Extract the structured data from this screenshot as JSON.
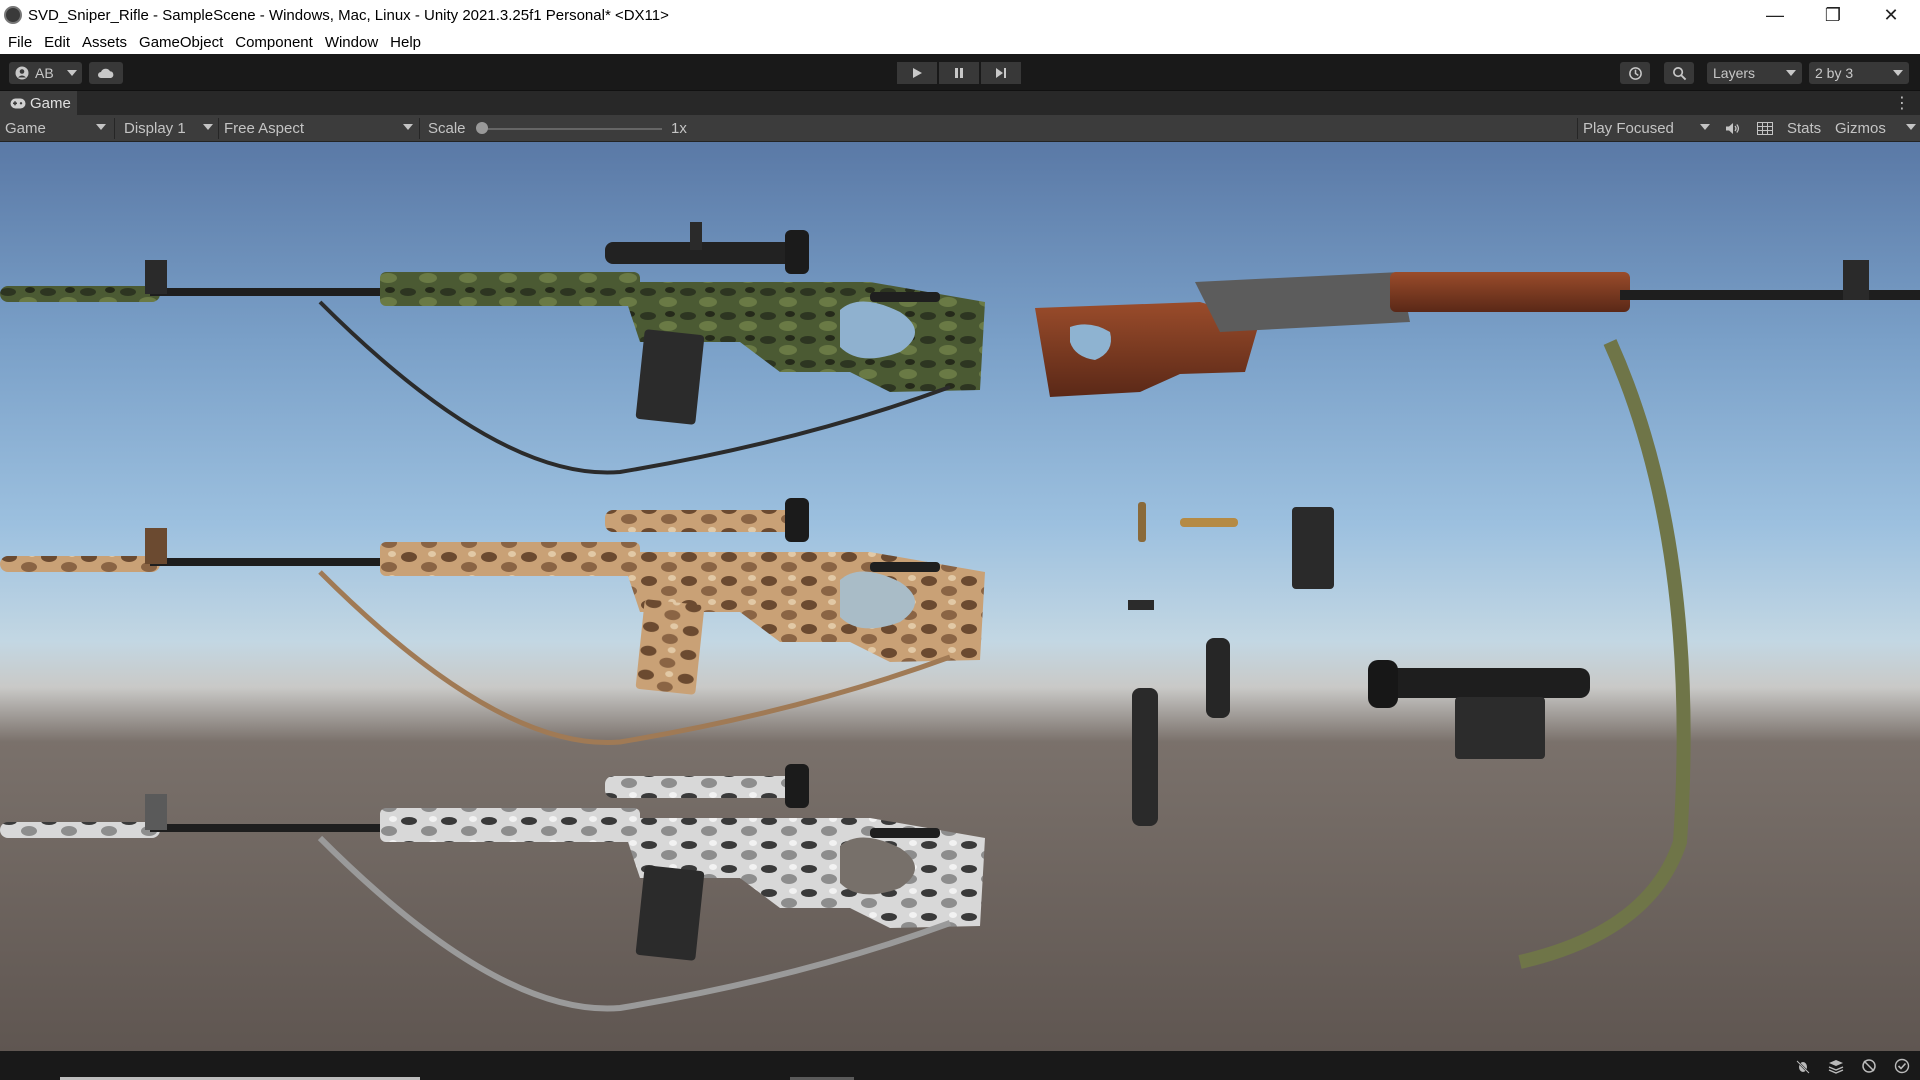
{
  "window": {
    "title": "SVD_Sniper_Rifle - SampleScene - Windows, Mac, Linux - Unity 2021.3.25f1 Personal* <DX11>",
    "controls": {
      "minimize": "—",
      "restore": "❐",
      "close": "✕"
    }
  },
  "menu": [
    "File",
    "Edit",
    "Assets",
    "GameObject",
    "Component",
    "Window",
    "Help"
  ],
  "toolbar": {
    "account_label": "AB",
    "layers_label": "Layers",
    "layout_label": "2 by 3",
    "icons": [
      "account-icon",
      "cloud-icon",
      "play-icon",
      "pause-icon",
      "step-icon",
      "history-icon",
      "search-icon"
    ]
  },
  "tab": {
    "label": "Game",
    "icon": "gamepad-icon"
  },
  "game_toolbar": {
    "view_mode": "Game",
    "display": "Display 1",
    "aspect": "Free Aspect",
    "scale_label": "Scale",
    "scale_value": "1x",
    "scale_level": 0,
    "play_mode": "Play Focused",
    "stats_label": "Stats",
    "gizmos_label": "Gizmos"
  },
  "status_icons": [
    "bug-icon",
    "layers-icon",
    "no-network-icon",
    "check-icon"
  ],
  "colors": {
    "camo_green": "#3f4a2c",
    "camo_desert": "#b28b62",
    "camo_winter": "#c8c8c8",
    "wood": "#7a3a22",
    "metal": "#222222",
    "sling_green": "#6f7548"
  }
}
